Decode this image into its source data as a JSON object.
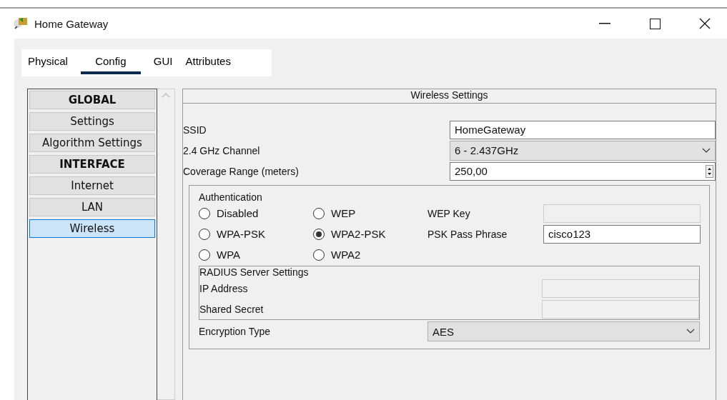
{
  "window": {
    "title": "Home Gateway"
  },
  "tabs": [
    {
      "label": "Physical",
      "selected": false
    },
    {
      "label": "Config",
      "selected": true
    },
    {
      "label": "GUI",
      "selected": false
    },
    {
      "label": "Attributes",
      "selected": false
    }
  ],
  "sidebar": {
    "items": [
      {
        "label": "GLOBAL",
        "kind": "header",
        "selected": false
      },
      {
        "label": "Settings",
        "kind": "item",
        "selected": false
      },
      {
        "label": "Algorithm Settings",
        "kind": "item",
        "selected": false
      },
      {
        "label": "INTERFACE",
        "kind": "header",
        "selected": false
      },
      {
        "label": "Internet",
        "kind": "item",
        "selected": false
      },
      {
        "label": "LAN",
        "kind": "item",
        "selected": false
      },
      {
        "label": "Wireless",
        "kind": "item",
        "selected": true
      }
    ]
  },
  "panel": {
    "title": "Wireless Settings",
    "ssid": {
      "label": "SSID",
      "value": "HomeGateway"
    },
    "channel": {
      "label": "2.4 GHz Channel",
      "value": "6 - 2.437GHz"
    },
    "coverage": {
      "label": "Coverage Range (meters)",
      "value": "250,00"
    },
    "authentication": {
      "title": "Authentication",
      "options": [
        {
          "label": "Disabled",
          "selected": false
        },
        {
          "label": "WEP",
          "selected": false
        },
        {
          "label": "WPA-PSK",
          "selected": false
        },
        {
          "label": "WPA2-PSK",
          "selected": true
        },
        {
          "label": "WPA",
          "selected": false
        },
        {
          "label": "WPA2",
          "selected": false
        }
      ],
      "wep_key": {
        "label": "WEP Key",
        "disabled": true
      },
      "psk_pass_phrase": {
        "label": "PSK Pass Phrase",
        "value": "cisco123",
        "disabled": false
      }
    },
    "radius": {
      "title": "RADIUS Server Settings",
      "ip_address": {
        "label": "IP Address",
        "disabled": true
      },
      "shared_secret": {
        "label": "Shared Secret",
        "disabled": true
      }
    },
    "encryption": {
      "label": "Encryption Type",
      "value": "AES"
    }
  }
}
